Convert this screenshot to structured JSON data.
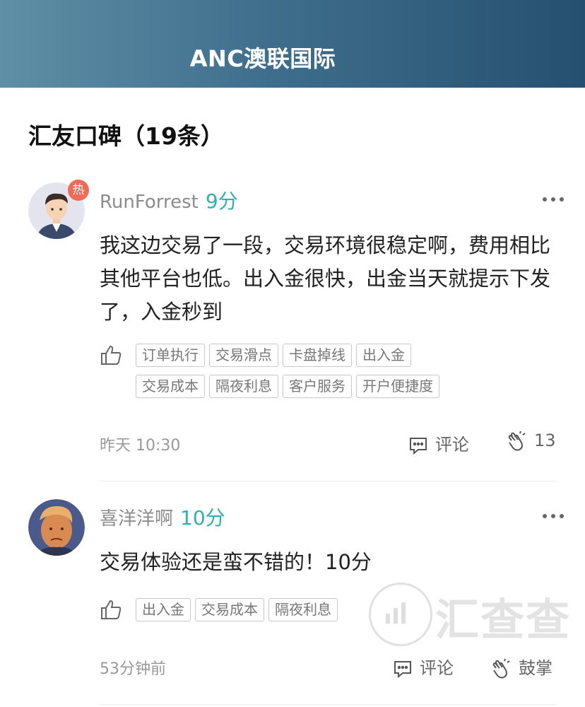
{
  "header": {
    "title": "ANC澳联国际"
  },
  "section": {
    "title": "汇友口碑（19条）"
  },
  "reviews": [
    {
      "username": "RunForrest",
      "score": "9分",
      "badge": "热",
      "content": "我这边交易了一段，交易环境很稳定啊，费用相比其他平台也低。出入金很快，出金当天就提示下发了，入金秒到",
      "tags": [
        "订单执行",
        "交易滑点",
        "卡盘掉线",
        "出入金",
        "交易成本",
        "隔夜利息",
        "客户服务",
        "开户便捷度"
      ],
      "time": "昨天 10:30",
      "comment_label": "评论",
      "clap_label": "13"
    },
    {
      "username": "喜洋洋啊",
      "score": "10分",
      "content": "交易体验还是蛮不错的！10分",
      "tags": [
        "出入金",
        "交易成本",
        "隔夜利息"
      ],
      "time": "53分钟前",
      "comment_label": "评论",
      "clap_label": "鼓掌"
    }
  ],
  "watermark": {
    "text": "汇查查"
  },
  "colors": {
    "score": "#2bb3b3",
    "badge": "#ef6b55",
    "header_start": "#5f8fa6",
    "header_end": "#26506f"
  },
  "icons": [
    "thumb-up-icon",
    "comment-icon",
    "clap-icon",
    "more-icon"
  ]
}
